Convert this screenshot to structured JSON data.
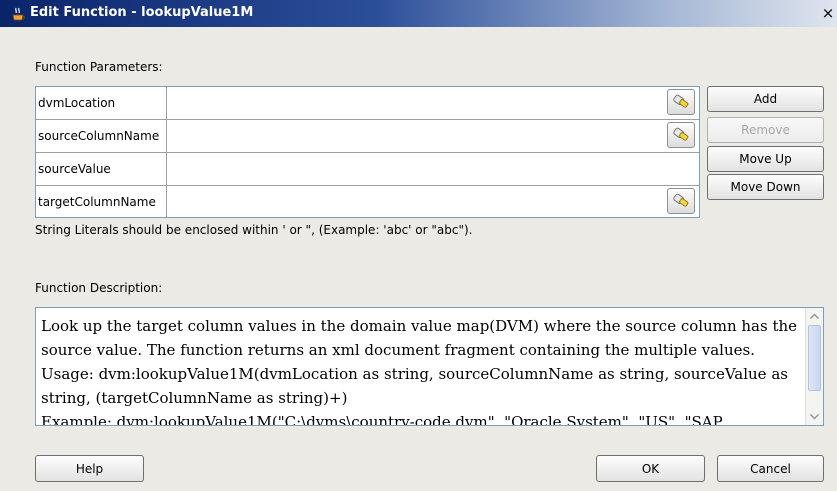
{
  "window": {
    "title": "Edit Function - lookupValue1M",
    "close_glyph": "×"
  },
  "params": {
    "section_label": "Function Parameters:",
    "rows": [
      {
        "name": "dvmLocation",
        "value": "",
        "has_tool": true
      },
      {
        "name": "sourceColumnName",
        "value": "",
        "has_tool": true
      },
      {
        "name": "sourceValue",
        "value": "",
        "has_tool": false
      },
      {
        "name": "targetColumnName",
        "value": "",
        "has_tool": true
      }
    ],
    "hint": "String Literals should be enclosed within ' or \", (Example: 'abc' or \"abc\")."
  },
  "buttons": {
    "add": "Add",
    "remove": "Remove",
    "move_up": "Move Up",
    "move_down": "Move Down",
    "help": "Help",
    "ok": "OK",
    "cancel": "Cancel"
  },
  "description": {
    "label": "Function Description:",
    "lines": [
      "Look up the target column values in the domain value map(DVM) where the source column has the",
      "source value. The function returns an xml document fragment containing the multiple values.",
      "Usage: dvm:lookupValue1M(dvmLocation as string, sourceColumnName as string, sourceValue as",
      "string, (targetColumnName as string)+)",
      "Example: dvm:lookupValue1M(\"C:\\dvms\\country-code.dvm\", \"Oracle System\", \"US\", \"SAP"
    ]
  },
  "icons": {
    "title": "dialog-app-icon",
    "row_tool": "browse-tool-icon"
  },
  "colors": {
    "title_bar_start": "#0a246a",
    "title_bar_end": "#dfe4ee",
    "dialog_bg": "#ebeae4",
    "field_border": "#7f9db9"
  }
}
